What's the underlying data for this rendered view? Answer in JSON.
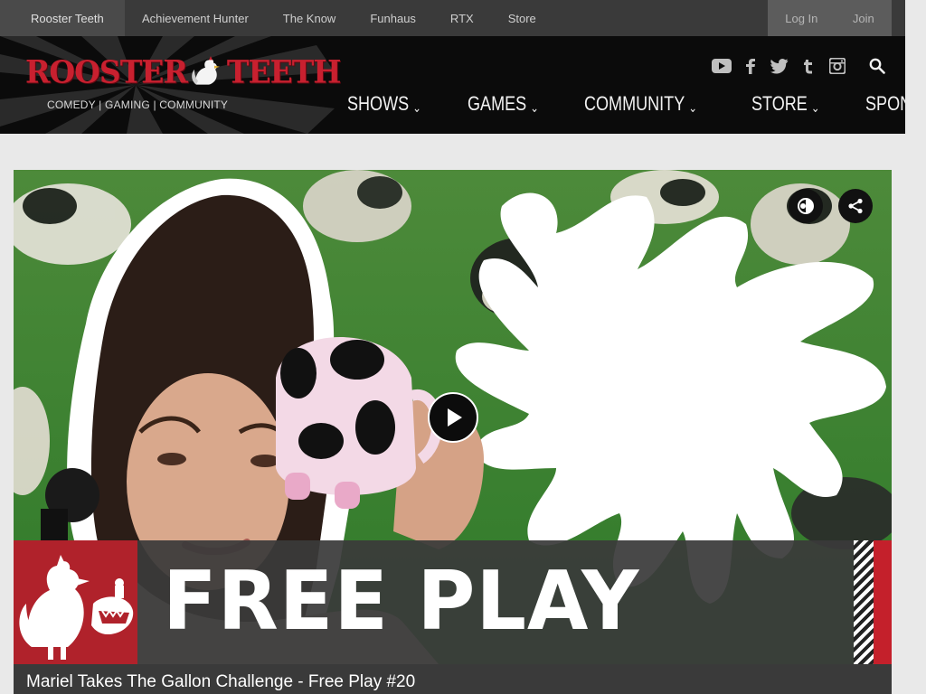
{
  "network_bar": {
    "items": [
      {
        "label": "Rooster Teeth"
      },
      {
        "label": "Achievement Hunter"
      },
      {
        "label": "The Know"
      },
      {
        "label": "Funhaus"
      },
      {
        "label": "RTX"
      },
      {
        "label": "Store"
      }
    ],
    "login_label": "Log In",
    "join_label": "Join"
  },
  "header": {
    "logo_part1": "ROOSTER",
    "logo_part2": "TEETH",
    "tagline": "COMEDY | GAMING | COMMUNITY",
    "socials": [
      "youtube-icon",
      "facebook-icon",
      "twitter-icon",
      "tumblr-icon",
      "instagram-icon"
    ],
    "nav": [
      {
        "label": "SHOWS"
      },
      {
        "label": "GAMES"
      },
      {
        "label": "COMMUNITY"
      },
      {
        "label": "STORE"
      },
      {
        "label": "SPONSOR"
      }
    ]
  },
  "video": {
    "banner_text": "FREE PLAY",
    "title": "Mariel Takes The Gallon Challenge - Free Play #20"
  },
  "colors": {
    "brand_red": "#c8202f",
    "header_bg": "#0b0b0b",
    "netbar_bg": "#3a3a3a",
    "sponsor_star": "#c9b46a"
  }
}
